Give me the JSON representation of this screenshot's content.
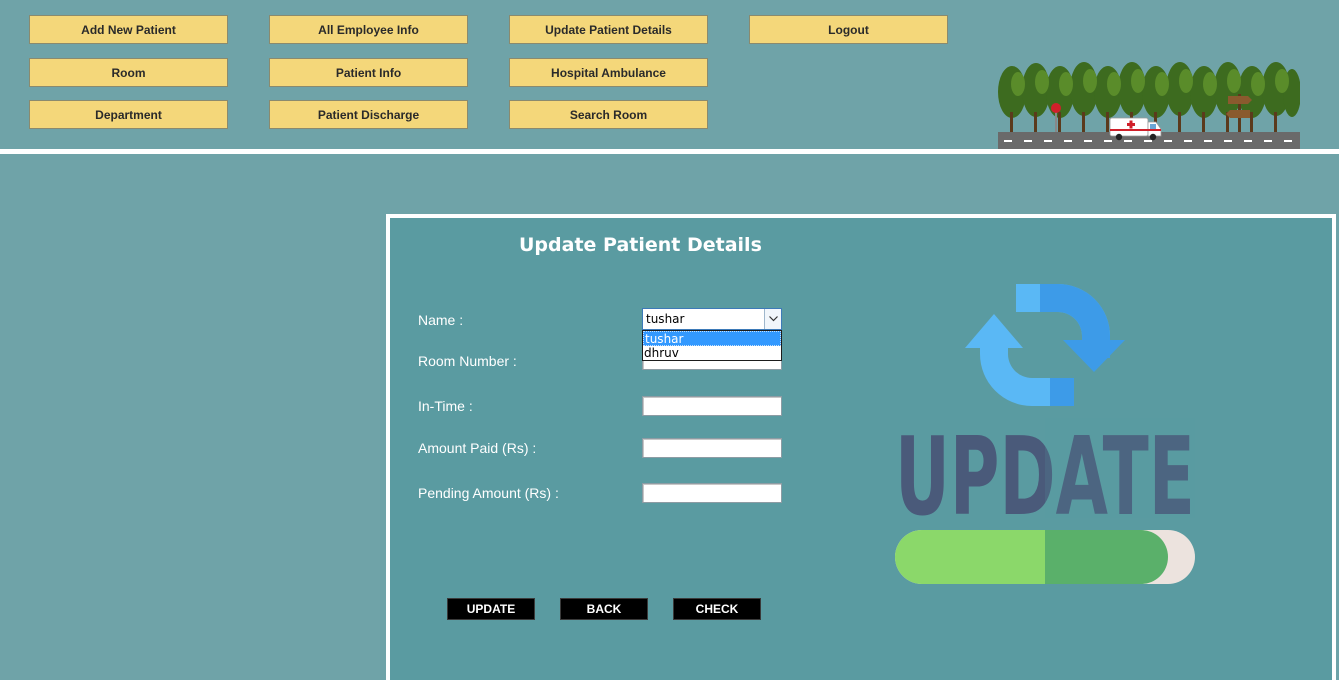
{
  "nav": {
    "items": [
      "Add New Patient",
      "All Employee Info",
      "Update Patient Details",
      "Logout",
      "Room",
      "Patient Info",
      "Hospital Ambulance",
      "Department",
      "Patient Discharge",
      "Search Room"
    ]
  },
  "form": {
    "title": "Update Patient Details",
    "labels": {
      "name": "Name :",
      "room": "Room Number :",
      "intime": "In-Time  :",
      "paid": "Amount Paid (Rs) :",
      "pending": "Pending Amount (Rs) :"
    },
    "name_selected": "tushar",
    "name_options": [
      "tushar",
      "dhruv"
    ],
    "values": {
      "room": "",
      "intime": "",
      "paid": "",
      "pending": ""
    }
  },
  "buttons": {
    "update": "UPDATE",
    "back": "BACK",
    "check": "CHECK"
  },
  "illustration": {
    "word": "UPDATE",
    "progress": 0.62
  },
  "colors": {
    "background": "#6fa3a8",
    "panel": "#5a9ba1",
    "nav_button": "#f4d77a",
    "arrow_light": "#5ab8f5",
    "arrow_dark": "#3d9be8",
    "word": "#4a5a7a",
    "progress_fill": "#8bd86a",
    "progress_track": "#ece3de"
  },
  "icons": [
    "chevron-down-icon",
    "refresh-icon"
  ]
}
